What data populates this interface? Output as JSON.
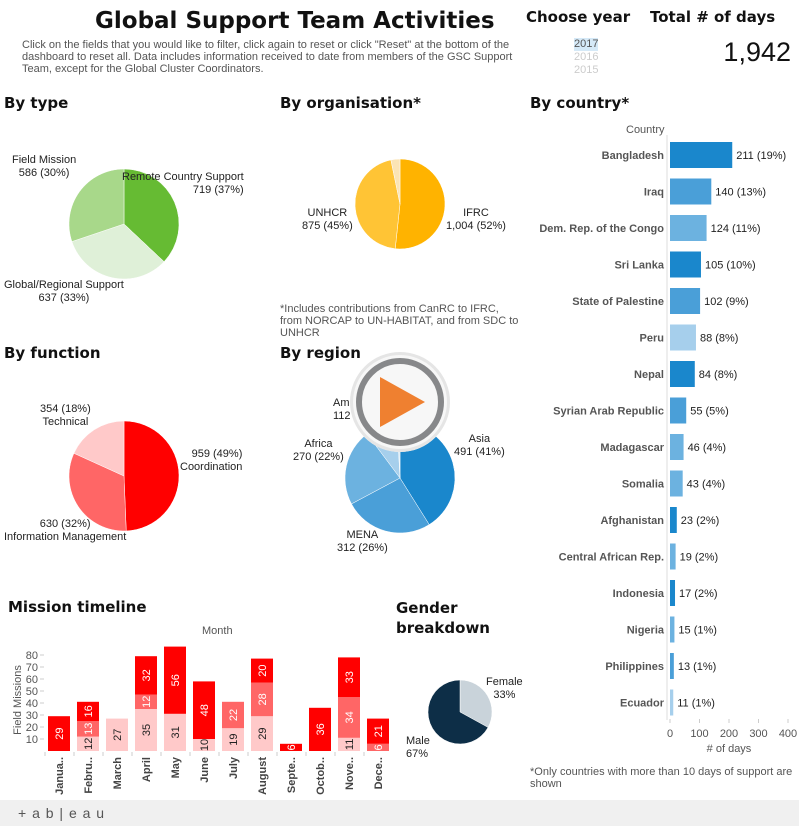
{
  "header": {
    "title": "Global Support Team Activities",
    "description": "Click on the fields that you would like to filter, click again to reset or click \"Reset\" at the bottom of the dashboard to reset all. Data includes information received to date from members of the GSC Support Team, except for the Global Cluster Coordinators."
  },
  "year_filter": {
    "title": "Choose year",
    "options": [
      "2017",
      "2016",
      "2015"
    ],
    "selected": "2017"
  },
  "total": {
    "title": "Total # of days",
    "value": "1,942"
  },
  "by_type": {
    "title": "By type",
    "slices": [
      {
        "label": "Remote Country Support",
        "value_label": "719 (37%)",
        "value": 719,
        "color": "#66bb33"
      },
      {
        "label": "Global/Regional Support",
        "value_label": "637 (33%)",
        "value": 637,
        "color": "#dff0d8"
      },
      {
        "label": "Field Mission",
        "value_label": "586 (30%)",
        "value": 586,
        "color": "#a8d88a"
      }
    ]
  },
  "by_org": {
    "title": "By organisation*",
    "slices": [
      {
        "label": "IFRC",
        "value_label": "1,004 (52%)",
        "value": 1004,
        "color": "#ffb300"
      },
      {
        "label": "UNHCR",
        "value_label": "875 (45%)",
        "value": 875,
        "color": "#ffc435"
      },
      {
        "label": "",
        "value_label": "",
        "value": 63,
        "color": "#fbe4b4"
      }
    ],
    "note": "*Includes contributions from CanRC to IFRC, from NORCAP to UN-HABITAT, and from SDC to UNHCR"
  },
  "by_function": {
    "title": "By function",
    "slices": [
      {
        "label": "Coordination",
        "value_label": "959 (49%)",
        "value": 959,
        "color": "#ff0000"
      },
      {
        "label": "Information Management",
        "value_label": "630 (32%)",
        "value": 630,
        "color": "#ff6666"
      },
      {
        "label": "Technical",
        "value_label": "354 (18%)",
        "value": 354,
        "color": "#ffc9c9"
      }
    ]
  },
  "by_region": {
    "title": "By region",
    "slices": [
      {
        "label": "Asia",
        "value_label": "491 (41%)",
        "value": 491,
        "color": "#1a87cc"
      },
      {
        "label": "MENA",
        "value_label": "312 (26%)",
        "value": 312,
        "color": "#4a9fd8"
      },
      {
        "label": "Africa",
        "value_label": "270 (22%)",
        "value": 270,
        "color": "#6cb2e0"
      },
      {
        "label": "Am",
        "value_label": "112",
        "value": 112,
        "color": "#a6cfec"
      },
      {
        "label": "",
        "value_label": "",
        "value": 10,
        "color": "#d9ebf7"
      }
    ]
  },
  "by_country": {
    "title": "By country*",
    "column_header": "Country",
    "axis_title": "# of days",
    "axis_ticks": [
      0,
      100,
      200,
      300,
      400
    ],
    "note": "*Only countries with more than 10 days of support are shown",
    "rows": [
      {
        "country": "Bangladesh",
        "value": 211,
        "label": "211 (19%)",
        "color": "#1a87cc"
      },
      {
        "country": "Iraq",
        "value": 140,
        "label": "140 (13%)",
        "color": "#4a9fd8"
      },
      {
        "country": "Dem. Rep. of the Congo",
        "value": 124,
        "label": "124 (11%)",
        "color": "#6cb2e0"
      },
      {
        "country": "Sri Lanka",
        "value": 105,
        "label": "105 (10%)",
        "color": "#1a87cc"
      },
      {
        "country": "State of Palestine",
        "value": 102,
        "label": "102 (9%)",
        "color": "#4a9fd8"
      },
      {
        "country": "Peru",
        "value": 88,
        "label": "88 (8%)",
        "color": "#a6cfec"
      },
      {
        "country": "Nepal",
        "value": 84,
        "label": "84 (8%)",
        "color": "#1a87cc"
      },
      {
        "country": "Syrian Arab Republic",
        "value": 55,
        "label": "55 (5%)",
        "color": "#4a9fd8"
      },
      {
        "country": "Madagascar",
        "value": 46,
        "label": "46 (4%)",
        "color": "#6cb2e0"
      },
      {
        "country": "Somalia",
        "value": 43,
        "label": "43 (4%)",
        "color": "#6cb2e0"
      },
      {
        "country": "Afghanistan",
        "value": 23,
        "label": "23 (2%)",
        "color": "#1a87cc"
      },
      {
        "country": "Central African Rep.",
        "value": 19,
        "label": "19 (2%)",
        "color": "#6cb2e0"
      },
      {
        "country": "Indonesia",
        "value": 17,
        "label": "17 (2%)",
        "color": "#1a87cc"
      },
      {
        "country": "Nigeria",
        "value": 15,
        "label": "15 (1%)",
        "color": "#6cb2e0"
      },
      {
        "country": "Philippines",
        "value": 13,
        "label": "13 (1%)",
        "color": "#4a9fd8"
      },
      {
        "country": "Ecuador",
        "value": 11,
        "label": "11 (1%)",
        "color": "#a6cfec"
      }
    ]
  },
  "timeline": {
    "title": "Mission timeline",
    "column_header": "Month",
    "ylabel": "Field Missions",
    "yticks": [
      10,
      20,
      30,
      40,
      50,
      60,
      70,
      80
    ],
    "colors": [
      "#ffc9c9",
      "#ff6666",
      "#ff0000"
    ],
    "months": [
      {
        "label": "Janua..",
        "values": [
          0,
          0,
          29
        ]
      },
      {
        "label": "Febru..",
        "values": [
          12,
          13,
          16
        ]
      },
      {
        "label": "March",
        "values": [
          27,
          0,
          0
        ]
      },
      {
        "label": "April",
        "values": [
          35,
          12,
          32
        ]
      },
      {
        "label": "May",
        "values": [
          31,
          0,
          56
        ]
      },
      {
        "label": "June",
        "values": [
          10,
          0,
          48
        ]
      },
      {
        "label": "July",
        "values": [
          19,
          22,
          0
        ]
      },
      {
        "label": "August",
        "values": [
          29,
          28,
          20
        ]
      },
      {
        "label": "Septe..",
        "values": [
          0,
          0,
          6
        ]
      },
      {
        "label": "Octob..",
        "values": [
          0,
          0,
          36
        ]
      },
      {
        "label": "Nove..",
        "values": [
          11,
          34,
          33
        ]
      },
      {
        "label": "Dece..",
        "values": [
          0,
          6,
          21
        ]
      }
    ]
  },
  "gender": {
    "title": "Gender breakdown",
    "slices": [
      {
        "label": "Female",
        "value_label": "33%",
        "value": 33,
        "color": "#c9d3da"
      },
      {
        "label": "Male",
        "value_label": "67%",
        "value": 67,
        "color": "#0d2e47"
      }
    ]
  },
  "footer": {
    "logo": "+ a b | e a u"
  }
}
